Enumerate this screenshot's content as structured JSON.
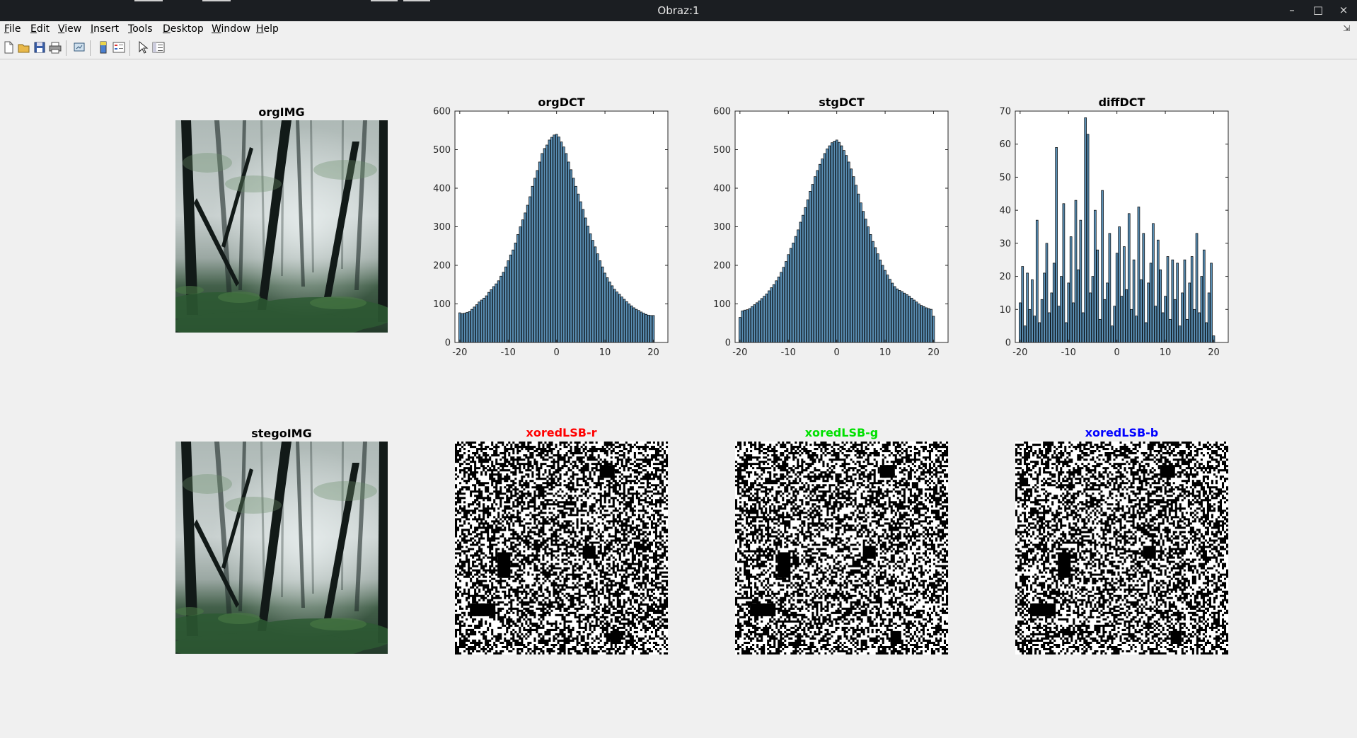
{
  "window": {
    "title": "Obraz:1",
    "buttons": {
      "minimize": "–",
      "maximize": "□",
      "close": "×"
    }
  },
  "menubar": {
    "items": [
      {
        "label": "File",
        "ul": "F",
        "rest": "ile"
      },
      {
        "label": "Edit",
        "ul": "E",
        "rest": "dit"
      },
      {
        "label": "View",
        "ul": "V",
        "rest": "iew"
      },
      {
        "label": "Insert",
        "ul": "I",
        "rest": "nsert"
      },
      {
        "label": "Tools",
        "ul": "T",
        "rest": "ools"
      },
      {
        "label": "Desktop",
        "ul": "D",
        "rest": "esktop"
      },
      {
        "label": "Window",
        "ul": "W",
        "rest": "indow"
      },
      {
        "label": "Help",
        "ul": "H",
        "rest": "elp"
      }
    ]
  },
  "toolbar": {
    "icons": [
      "new-figure-icon",
      "open-file-icon",
      "save-icon",
      "print-icon",
      "link-figure-icon",
      "colorbar-icon",
      "legend-icon",
      "edit-plot-pointer-icon",
      "property-inspector-icon"
    ]
  },
  "images": {
    "orig": {
      "title": "orgIMG",
      "description": "misty forest"
    },
    "stego": {
      "title": "stegoIMG",
      "description": "misty forest"
    }
  },
  "lsb_maps": [
    {
      "title": "xoredLSB-r",
      "color": "#ff0000"
    },
    {
      "title": "xoredLSB-g",
      "color": "#00e000"
    },
    {
      "title": "xoredLSB-b",
      "color": "#0000ff"
    }
  ],
  "colors": {
    "bar_fill": "#5a8fb5",
    "bar_edge": "#000000",
    "axes_bg": "#ffffff"
  },
  "chart_data": [
    {
      "type": "bar",
      "title": "orgDCT",
      "xlabel": "",
      "ylabel": "",
      "xlim": [
        -21,
        23
      ],
      "ylim": [
        0,
        600
      ],
      "xticks": [
        -20,
        -10,
        0,
        10,
        20
      ],
      "yticks": [
        0,
        100,
        200,
        300,
        400,
        500,
        600
      ],
      "grid": false,
      "x": [
        -20,
        -19.5,
        -19,
        -18.5,
        -18,
        -17.5,
        -17,
        -16.5,
        -16,
        -15.5,
        -15,
        -14.5,
        -14,
        -13.5,
        -13,
        -12.5,
        -12,
        -11.5,
        -11,
        -10.5,
        -10,
        -9.5,
        -9,
        -8.5,
        -8,
        -7.5,
        -7,
        -6.5,
        -6,
        -5.5,
        -5,
        -4.5,
        -4,
        -3.5,
        -3,
        -2.5,
        -2,
        -1.5,
        -1,
        -0.5,
        0,
        0.5,
        1,
        1.5,
        2,
        2.5,
        3,
        3.5,
        4,
        4.5,
        5,
        5.5,
        6,
        6.5,
        7,
        7.5,
        8,
        8.5,
        9,
        9.5,
        10,
        10.5,
        11,
        11.5,
        12,
        12.5,
        13,
        13.5,
        14,
        14.5,
        15,
        15.5,
        16,
        16.5,
        17,
        17.5,
        18,
        18.5,
        19,
        19.5,
        20
      ],
      "values": [
        77,
        75,
        76,
        78,
        80,
        86,
        92,
        98,
        105,
        110,
        115,
        121,
        130,
        137,
        145,
        152,
        160,
        172,
        182,
        196,
        212,
        227,
        240,
        258,
        280,
        300,
        318,
        336,
        356,
        378,
        405,
        426,
        446,
        468,
        490,
        503,
        512,
        525,
        532,
        538,
        540,
        533,
        520,
        507,
        490,
        468,
        448,
        426,
        405,
        385,
        365,
        345,
        323,
        302,
        282,
        265,
        248,
        230,
        212,
        196,
        180,
        168,
        157,
        147,
        138,
        131,
        125,
        118,
        112,
        106,
        100,
        95,
        90,
        86,
        83,
        79,
        76,
        73,
        71,
        70,
        70
      ]
    },
    {
      "type": "bar",
      "title": "stgDCT",
      "xlabel": "",
      "ylabel": "",
      "xlim": [
        -21,
        23
      ],
      "ylim": [
        0,
        600
      ],
      "xticks": [
        -20,
        -10,
        0,
        10,
        20
      ],
      "yticks": [
        0,
        100,
        200,
        300,
        400,
        500,
        600
      ],
      "grid": false,
      "x": [
        -20,
        -19.5,
        -19,
        -18.5,
        -18,
        -17.5,
        -17,
        -16.5,
        -16,
        -15.5,
        -15,
        -14.5,
        -14,
        -13.5,
        -13,
        -12.5,
        -12,
        -11.5,
        -11,
        -10.5,
        -10,
        -9.5,
        -9,
        -8.5,
        -8,
        -7.5,
        -7,
        -6.5,
        -6,
        -5.5,
        -5,
        -4.5,
        -4,
        -3.5,
        -3,
        -2.5,
        -2,
        -1.5,
        -1,
        -0.5,
        0,
        0.5,
        1,
        1.5,
        2,
        2.5,
        3,
        3.5,
        4,
        4.5,
        5,
        5.5,
        6,
        6.5,
        7,
        7.5,
        8,
        8.5,
        9,
        9.5,
        10,
        10.5,
        11,
        11.5,
        12,
        12.5,
        13,
        13.5,
        14,
        14.5,
        15,
        15.5,
        16,
        16.5,
        17,
        17.5,
        18,
        18.5,
        19,
        19.5,
        20
      ],
      "values": [
        65,
        82,
        84,
        85,
        88,
        93,
        98,
        103,
        108,
        114,
        120,
        126,
        134,
        142,
        150,
        160,
        170,
        182,
        195,
        210,
        228,
        244,
        258,
        275,
        292,
        312,
        330,
        350,
        370,
        392,
        410,
        430,
        446,
        462,
        476,
        490,
        502,
        510,
        518,
        522,
        525,
        519,
        510,
        498,
        485,
        468,
        450,
        430,
        408,
        385,
        362,
        340,
        320,
        300,
        280,
        262,
        246,
        230,
        214,
        200,
        187,
        175,
        164,
        154,
        145,
        139,
        135,
        132,
        128,
        124,
        120,
        115,
        110,
        105,
        100,
        96,
        93,
        90,
        88,
        86,
        68
      ]
    },
    {
      "type": "bar",
      "title": "diffDCT",
      "xlabel": "",
      "ylabel": "",
      "xlim": [
        -21,
        23
      ],
      "ylim": [
        0,
        70
      ],
      "xticks": [
        -20,
        -10,
        0,
        10,
        20
      ],
      "yticks": [
        0,
        10,
        20,
        30,
        40,
        50,
        60,
        70
      ],
      "grid": false,
      "x": [
        -20,
        -19.5,
        -19,
        -18.5,
        -18,
        -17.5,
        -17,
        -16.5,
        -16,
        -15.5,
        -15,
        -14.5,
        -14,
        -13.5,
        -13,
        -12.5,
        -12,
        -11.5,
        -11,
        -10.5,
        -10,
        -9.5,
        -9,
        -8.5,
        -8,
        -7.5,
        -7,
        -6.5,
        -6,
        -5.5,
        -5,
        -4.5,
        -4,
        -3.5,
        -3,
        -2.5,
        -2,
        -1.5,
        -1,
        -0.5,
        0,
        0.5,
        1,
        1.5,
        2,
        2.5,
        3,
        3.5,
        4,
        4.5,
        5,
        5.5,
        6,
        6.5,
        7,
        7.5,
        8,
        8.5,
        9,
        9.5,
        10,
        10.5,
        11,
        11.5,
        12,
        12.5,
        13,
        13.5,
        14,
        14.5,
        15,
        15.5,
        16,
        16.5,
        17,
        17.5,
        18,
        18.5,
        19,
        19.5,
        20
      ],
      "values": [
        12,
        23,
        5,
        21,
        10,
        19,
        8,
        37,
        6,
        13,
        21,
        30,
        9,
        15,
        24,
        59,
        11,
        20,
        42,
        6,
        18,
        32,
        12,
        43,
        22,
        37,
        9,
        68,
        63,
        15,
        20,
        40,
        28,
        7,
        46,
        13,
        18,
        33,
        5,
        11,
        27,
        35,
        14,
        29,
        16,
        39,
        10,
        25,
        8,
        41,
        19,
        33,
        6,
        18,
        24,
        36,
        11,
        31,
        22,
        9,
        14,
        26,
        7,
        25,
        13,
        24,
        5,
        15,
        25,
        7,
        18,
        26,
        10,
        33,
        9,
        20,
        28,
        6,
        15,
        24,
        2
      ]
    }
  ]
}
